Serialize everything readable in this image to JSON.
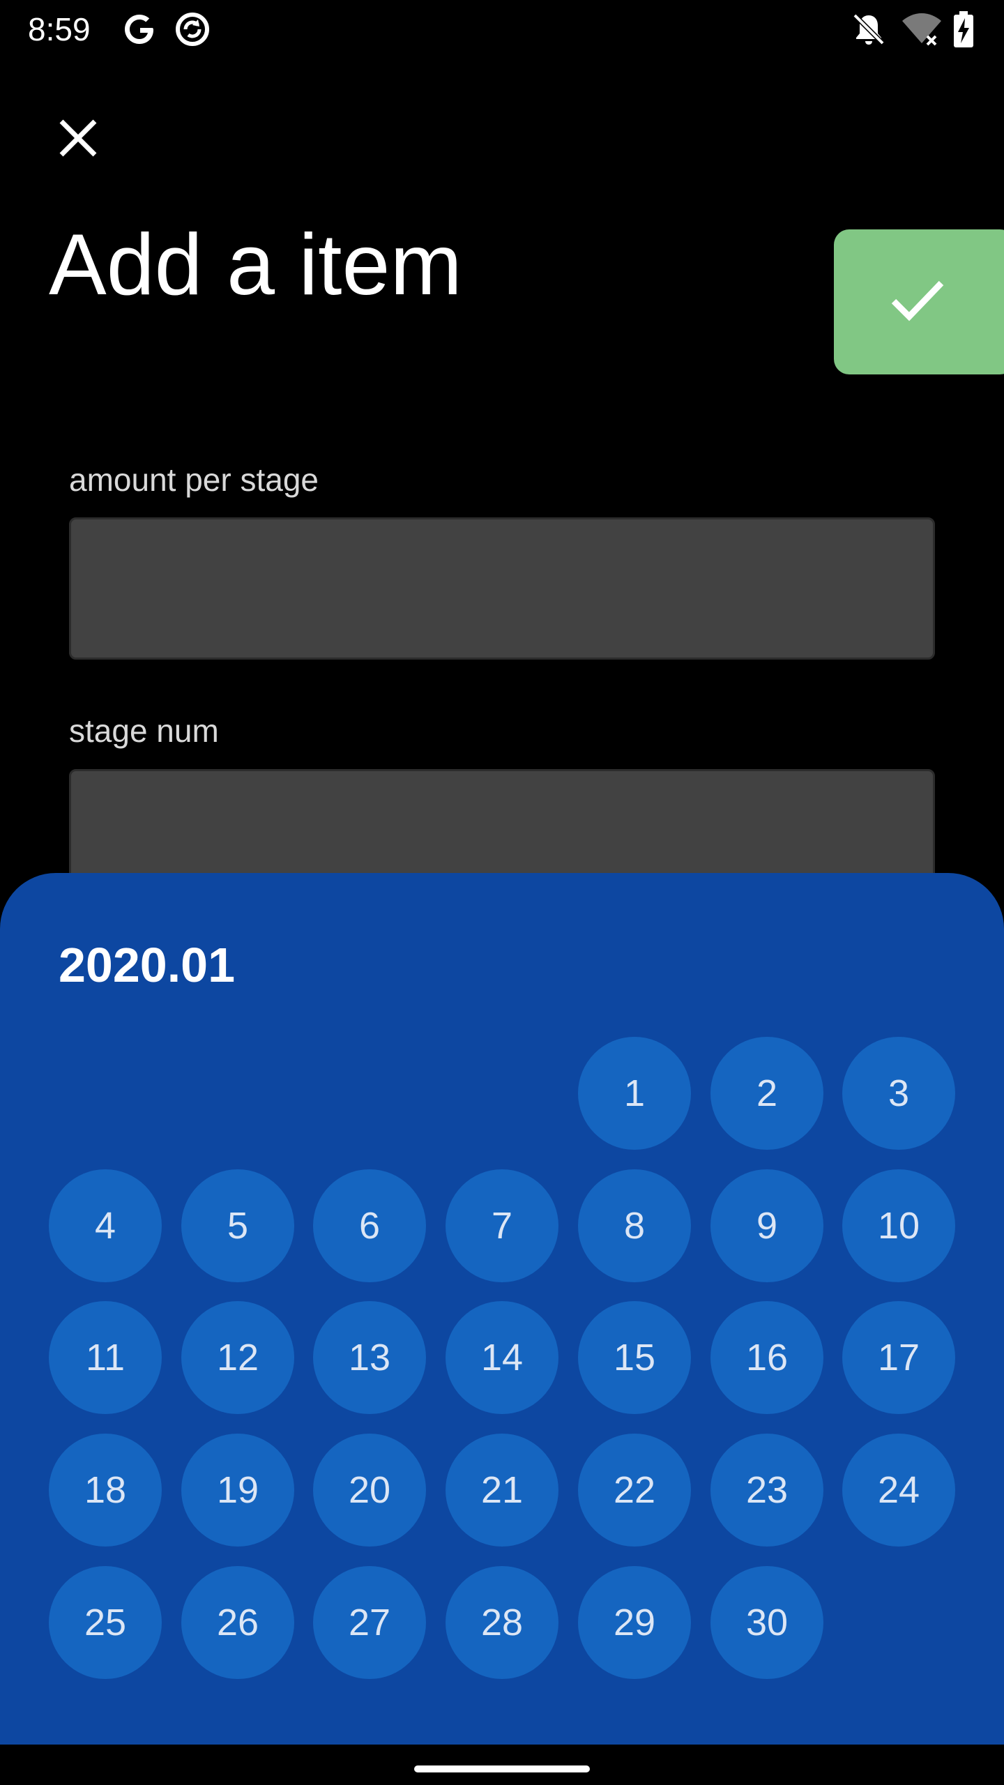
{
  "status_bar": {
    "time": "8:59",
    "left_icons": [
      "google-g-icon",
      "sync-circle-icon"
    ],
    "right_icons": [
      "notifications-off-icon",
      "wifi-off-icon",
      "battery-charging-icon"
    ]
  },
  "header": {
    "close_icon": "close-icon",
    "title": "Add a item",
    "confirm_icon": "check-icon",
    "confirm_color": "#81c784"
  },
  "form": {
    "fields": [
      {
        "label": "amount per stage",
        "value": ""
      },
      {
        "label": "stage num",
        "value": ""
      }
    ]
  },
  "date_picker": {
    "month_label": "2020.01",
    "background_color": "#0d47a1",
    "day_color": "#1565c0",
    "first_weekday_column": 4,
    "days": [
      "1",
      "2",
      "3",
      "4",
      "5",
      "6",
      "7",
      "8",
      "9",
      "10",
      "11",
      "12",
      "13",
      "14",
      "15",
      "16",
      "17",
      "18",
      "19",
      "20",
      "21",
      "22",
      "23",
      "24",
      "25",
      "26",
      "27",
      "28",
      "29",
      "30"
    ]
  }
}
